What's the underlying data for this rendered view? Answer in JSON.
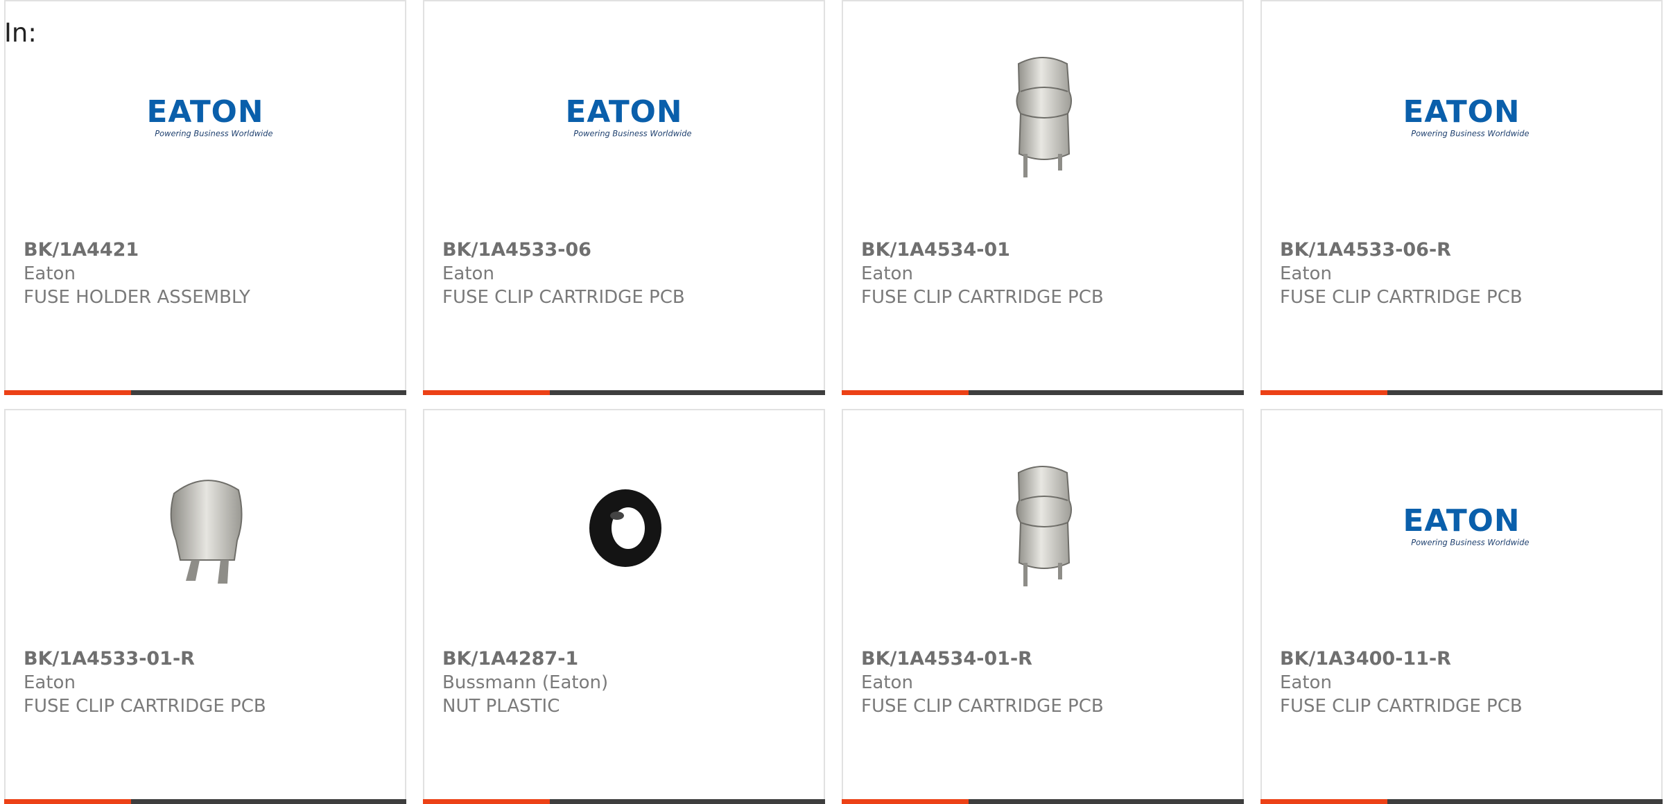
{
  "filter_label": "In:",
  "colors": {
    "accent": "#ec4116",
    "bar": "#3e3e3e",
    "eaton_blue": "#0a5fab",
    "text": "#6f6f6f"
  },
  "products": [
    {
      "part_number": "BK/1A4421",
      "manufacturer": "Eaton",
      "description": "FUSE HOLDER ASSEMBLY",
      "image": "eaton-logo",
      "logo_text": "EATON",
      "logo_tagline": "Powering Business Worldwide"
    },
    {
      "part_number": "BK/1A4533-06",
      "manufacturer": "Eaton",
      "description": "FUSE CLIP CARTRIDGE PCB",
      "image": "eaton-logo",
      "logo_text": "EATON",
      "logo_tagline": "Powering Business Worldwide"
    },
    {
      "part_number": "BK/1A4534-01",
      "manufacturer": "Eaton",
      "description": "FUSE CLIP CARTRIDGE PCB",
      "image": "fuse-clip-tall"
    },
    {
      "part_number": "BK/1A4533-06-R",
      "manufacturer": "Eaton",
      "description": "FUSE CLIP CARTRIDGE PCB",
      "image": "eaton-logo",
      "logo_text": "EATON",
      "logo_tagline": "Powering Business Worldwide"
    },
    {
      "part_number": "BK/1A4533-01-R",
      "manufacturer": "Eaton",
      "description": "FUSE CLIP CARTRIDGE PCB",
      "image": "fuse-clip-short"
    },
    {
      "part_number": "BK/1A4287-1",
      "manufacturer": "Bussmann (Eaton)",
      "description": "NUT PLASTIC",
      "image": "plastic-nut"
    },
    {
      "part_number": "BK/1A4534-01-R",
      "manufacturer": "Eaton",
      "description": "FUSE CLIP CARTRIDGE PCB",
      "image": "fuse-clip-tall"
    },
    {
      "part_number": "BK/1A3400-11-R",
      "manufacturer": "Eaton",
      "description": "FUSE CLIP CARTRIDGE PCB",
      "image": "eaton-logo",
      "logo_text": "EATON",
      "logo_tagline": "Powering Business Worldwide"
    }
  ]
}
